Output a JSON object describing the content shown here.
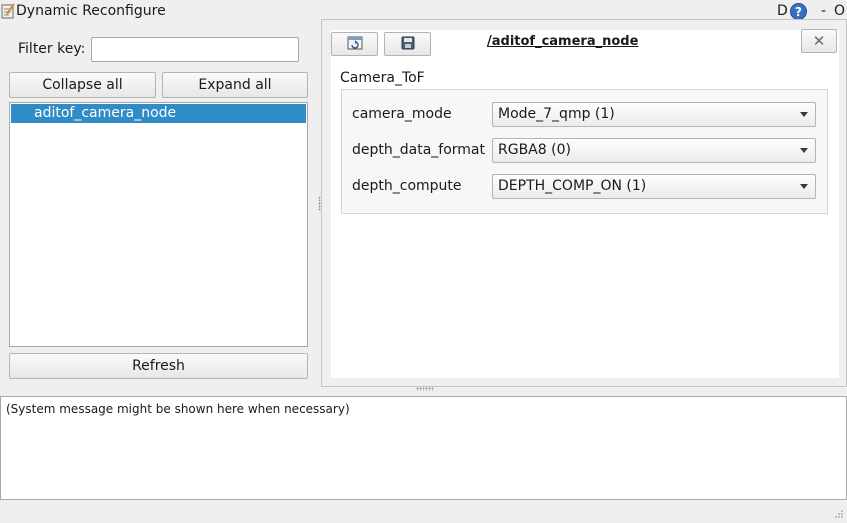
{
  "window": {
    "title": "Dynamic Reconfigure",
    "title_d": "D",
    "help_glyph": "?",
    "min_glyph": "-",
    "close_glyph": "O"
  },
  "left_panel": {
    "filter_label": "Filter key:",
    "filter_value": "",
    "collapse_label": "Collapse all",
    "expand_label": "Expand all",
    "tree_items": [
      "aditof_camera_node"
    ],
    "selected_item": "aditof_camera_node",
    "refresh_label": "Refresh"
  },
  "node_panel": {
    "node_name": "/aditof_camera_node",
    "reload_icon": "reload-params-icon",
    "save_icon": "save-icon",
    "close_glyph": "✕",
    "group_name": "Camera_ToF",
    "params": [
      {
        "name": "camera_mode",
        "value": "Mode_7_qmp (1)"
      },
      {
        "name": "depth_data_format",
        "value": "RGBA8 (0)"
      },
      {
        "name": "depth_compute",
        "value": "DEPTH_COMP_ON (1)"
      }
    ]
  },
  "status": {
    "message": "(System message might be shown here when necessary)"
  },
  "colors": {
    "selection": "#308cc6",
    "help_icon": "#3a6fc4"
  }
}
